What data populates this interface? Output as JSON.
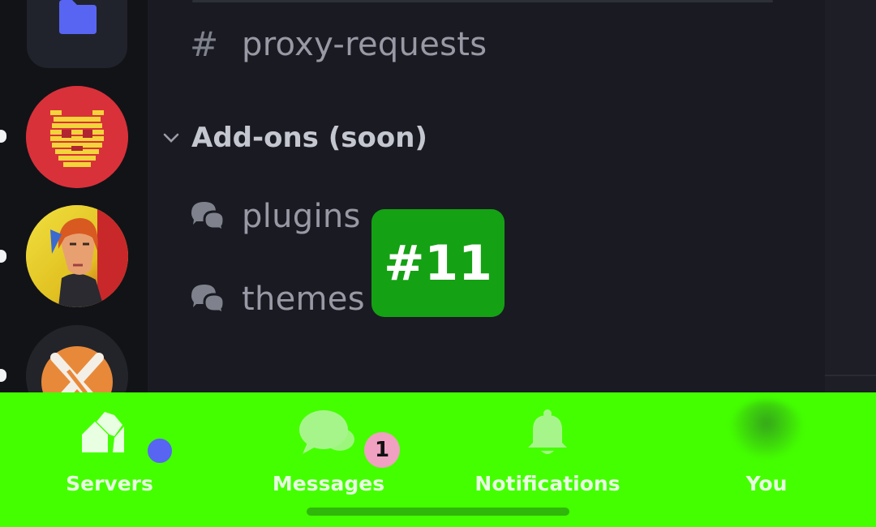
{
  "channels": {
    "text_channel": {
      "icon": "hash-icon",
      "name": "proxy-requests"
    },
    "category": {
      "icon": "chevron-down-icon",
      "name": "Add-ons (soon)"
    },
    "forum_channels": [
      {
        "icon": "forum-icon",
        "name": "plugins"
      },
      {
        "icon": "forum-icon",
        "name": "themes"
      }
    ]
  },
  "marker": {
    "label": "#11",
    "color": "#15a114"
  },
  "server_rail": {
    "folder": {
      "icon": "folder-icon",
      "color": "#5865f2"
    },
    "servers": [
      {
        "icon": "pixel-pikachu-avatar",
        "unread": true
      },
      {
        "icon": "cyberpunk-portrait-avatar",
        "unread": true
      },
      {
        "icon": "orange-x-logo-avatar",
        "unread": true
      }
    ]
  },
  "tab_bar": {
    "background": "#44ff00",
    "tabs": [
      {
        "label": "Servers",
        "icon": "servers-icon",
        "status_color": "#5865f2"
      },
      {
        "label": "Messages",
        "icon": "chat-bubbles-icon",
        "badge": "1"
      },
      {
        "label": "Notifications",
        "icon": "bell-icon"
      },
      {
        "label": "You",
        "icon": "avatar-icon"
      }
    ]
  }
}
